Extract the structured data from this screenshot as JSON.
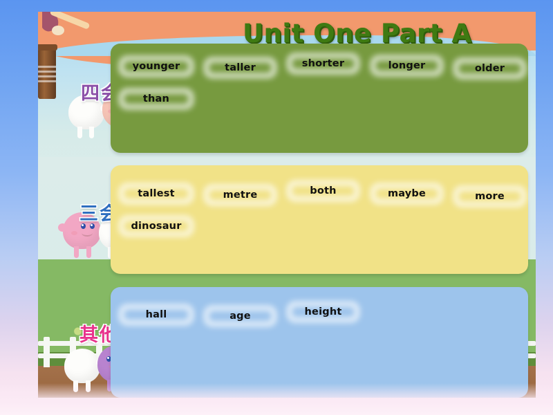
{
  "slide": {
    "title": "Unit One Part A"
  },
  "theme": {
    "title_color": "#3f7a12",
    "green_panel": "#779a3f",
    "yellow_panel": "#f1e287",
    "blue_panel": "#9dc4ec",
    "label_purple": "#8b4fa8",
    "label_blue": "#2f6fc0",
    "label_pink": "#e8338c",
    "frame_blue": "#5b95f0",
    "sky_blue": "#a9d8ee",
    "peach_band": "#f2996d",
    "chip_text": "#111111"
  },
  "sections": [
    {
      "id": "si-hui",
      "label": "四会",
      "label_color": "#8b4fa8",
      "panel_color": "#779a3f",
      "words": [
        "younger",
        "taller",
        "shorter",
        "longer",
        "older",
        "than"
      ]
    },
    {
      "id": "san-hui",
      "label": "三会",
      "label_color": "#2f6fc0",
      "panel_color": "#f1e287",
      "words": [
        "tallest",
        "metre",
        "both",
        "maybe",
        "more",
        "dinosaur"
      ]
    },
    {
      "id": "qi-ta",
      "label": "其他",
      "label_color": "#e8338c",
      "panel_color": "#9dc4ec",
      "words": [
        "hall",
        "age",
        "height"
      ]
    }
  ],
  "decor": {
    "creatures": [
      {
        "name": "white-creature-top",
        "color": "#fdfdfb"
      },
      {
        "name": "pink-creature-top",
        "color": "#f6c4b6"
      },
      {
        "name": "pink-creature-mid",
        "color": "#f2a7c4"
      },
      {
        "name": "white-creature-mid",
        "color": "#fdfdfb"
      },
      {
        "name": "white-creature-bottom",
        "color": "#fdfdfb"
      },
      {
        "name": "purple-creature-bottom",
        "color": "#b883cf"
      }
    ]
  }
}
